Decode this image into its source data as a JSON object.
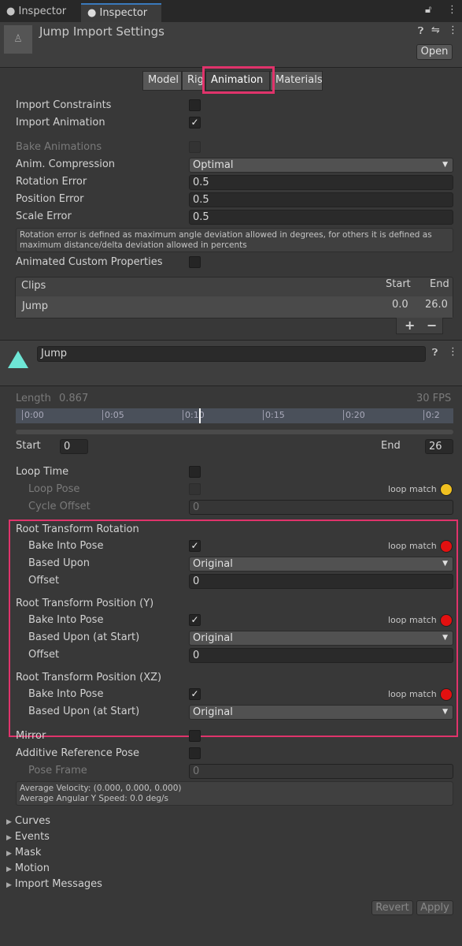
{
  "tabs": [
    {
      "label": "Inspector",
      "icon": "info-icon"
    },
    {
      "label": "Inspector",
      "icon": "info-icon",
      "active": true
    }
  ],
  "header": {
    "title": "Jump Import Settings",
    "open_label": "Open"
  },
  "segments": [
    "Model",
    "Rig",
    "Animation",
    "Materials"
  ],
  "active_segment": "Animation",
  "highlight_color": "#e0336b",
  "import": {
    "import_constraints": {
      "label": "Import Constraints",
      "checked": false
    },
    "import_animation": {
      "label": "Import Animation",
      "checked": true
    },
    "bake_animations": {
      "label": "Bake Animations",
      "checked": false
    },
    "anim_compression": {
      "label": "Anim. Compression",
      "value": "Optimal"
    },
    "rotation_error": {
      "label": "Rotation Error",
      "value": "0.5"
    },
    "position_error": {
      "label": "Position Error",
      "value": "0.5"
    },
    "scale_error": {
      "label": "Scale Error",
      "value": "0.5"
    },
    "help": "Rotation error is defined as maximum angle deviation allowed in degrees, for others it is defined as maximum distance/delta deviation allowed in percents",
    "animated_custom_properties": {
      "label": "Animated Custom Properties",
      "checked": false
    }
  },
  "clips": {
    "header": "Clips",
    "start_header": "Start",
    "end_header": "End",
    "rows": [
      {
        "name": "Jump",
        "start": "0.0",
        "end": "26.0"
      }
    ],
    "add": "+",
    "remove": "−"
  },
  "clip": {
    "name": "Jump",
    "length_label": "Length",
    "length": "0.867",
    "fps": "30 FPS",
    "ticks": [
      "0:00",
      "0:05",
      "0:10",
      "0:15",
      "0:20",
      "0:2"
    ],
    "start_label": "Start",
    "start": "0",
    "end_label": "End",
    "end": "26"
  },
  "loop": {
    "loop_time": {
      "label": "Loop Time",
      "checked": false
    },
    "loop_pose": {
      "label": "Loop Pose",
      "checked": false,
      "match": "loop match",
      "match_color": "#f0c020"
    },
    "cycle_offset": {
      "label": "Cycle Offset",
      "value": "0"
    }
  },
  "rtr": {
    "title": "Root Transform Rotation",
    "bake": "Bake Into Pose",
    "based": "Based Upon",
    "based_value": "Original",
    "offset": "Offset",
    "offset_value": "0",
    "match": "loop match",
    "match_color": "#e31010"
  },
  "rty": {
    "title": "Root Transform Position (Y)",
    "bake": "Bake Into Pose",
    "based": "Based Upon (at Start)",
    "based_value": "Original",
    "offset": "Offset",
    "offset_value": "0",
    "match": "loop match",
    "match_color": "#e31010"
  },
  "rtxz": {
    "title": "Root Transform Position (XZ)",
    "bake": "Bake Into Pose",
    "based": "Based Upon (at Start)",
    "based_value": "Original",
    "match": "loop match",
    "match_color": "#e31010"
  },
  "misc": {
    "mirror": "Mirror",
    "additive": "Additive Reference Pose",
    "pose_frame": "Pose Frame",
    "pose_frame_value": "0",
    "info1": "Average Velocity: (0.000, 0.000, 0.000)",
    "info2": "Average Angular Y Speed: 0.0 deg/s"
  },
  "foldouts": [
    "Curves",
    "Events",
    "Mask",
    "Motion",
    "Import Messages"
  ],
  "footer": {
    "revert": "Revert",
    "apply": "Apply"
  }
}
